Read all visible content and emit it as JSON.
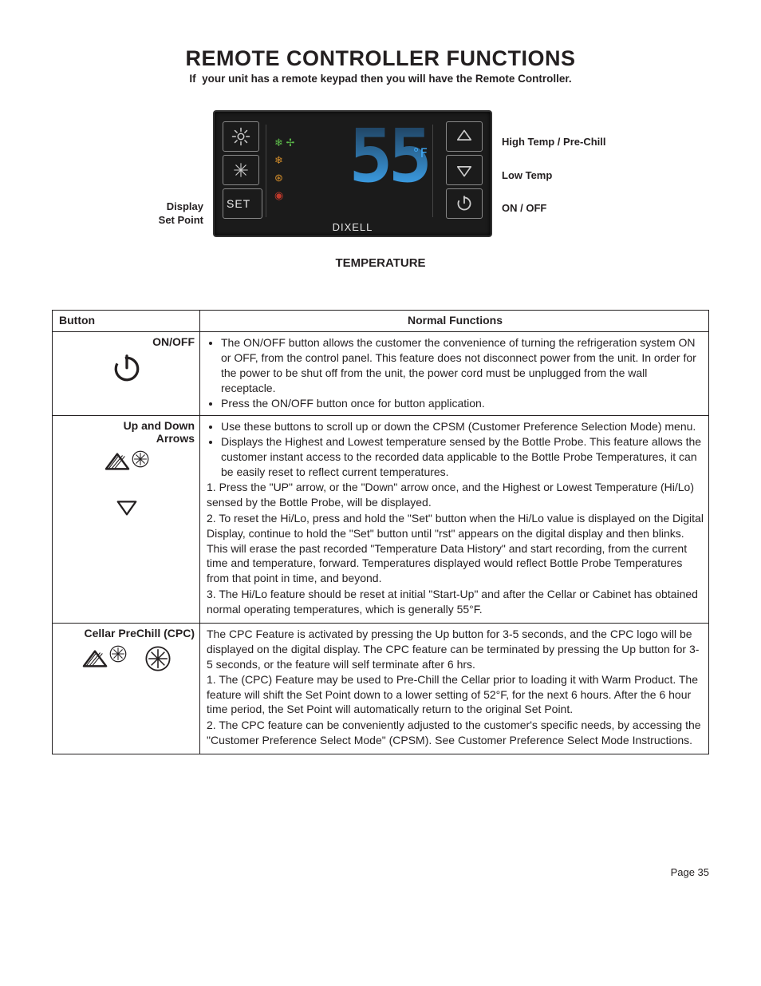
{
  "heading": "REMOTE CONTROLLER FUNCTIONS",
  "subheading_prefix": "If",
  "subheading_rest": "your unit has a remote keypad then you will have the Remote Controller.",
  "left_label_line1": "Display",
  "left_label_line2": "Set Point",
  "right_label_1": "High Temp / Pre-Chill",
  "right_label_2": "Low Temp",
  "right_label_3": "ON / OFF",
  "device": {
    "brand": "DIXELL",
    "set_label": "SET",
    "lcd_value": "55",
    "lcd_unit": "°F"
  },
  "section_head": "TEMPERATURE",
  "table": {
    "col1": "Button",
    "col2": "Normal Functions",
    "row1": {
      "label": "ON/OFF",
      "b1": "The ON/OFF button allows the customer the convenience of turning the refrigeration system ON or OFF, from the control panel.  This feature does not disconnect power from the unit.  In order for the power to be shut off from the unit, the power cord must be unplugged from the wall receptacle.",
      "b2": "Press the ON/OFF button once for button application."
    },
    "row2": {
      "label_l1": "Up and Down",
      "label_l2": "Arrows",
      "b1": "Use these buttons to scroll up or down the CPSM (Customer Preference Selection Mode) menu.",
      "b2": "Displays the Highest and Lowest temperature sensed by the Bottle Probe.  This feature allows the customer instant access to the recorded data applicable to the Bottle Probe Temperatures, it can be easily reset to reflect current temperatures.",
      "s1": "1.  Press the \"UP\" arrow, or the \"Down\" arrow once, and the Highest or Lowest Temperature (Hi/Lo) sensed by the Bottle Probe, will be displayed.",
      "s2": "2.  To reset the Hi/Lo, press and hold the \"Set\" button when the Hi/Lo value is displayed on the Digital Display, continue to hold the \"Set\" button until \"rst\" appears on the digital display and then blinks.  This will erase the past recorded \"Temperature Data History\" and start recording, from the current time and temperature, forward.  Temperatures displayed would reflect Bottle Probe Temperatures from that point in time, and beyond.",
      "s3": "3.  The Hi/Lo feature should be reset at initial \"Start-Up\" and after the Cellar or Cabinet has obtained normal operating temperatures, which is generally 55°F."
    },
    "row3": {
      "label": "Cellar PreChill (CPC)",
      "intro": "The CPC Feature is activated by pressing the Up button for 3-5 seconds, and the CPC logo will be displayed on the digital display.  The CPC feature can be terminated by pressing the Up button for 3-5 seconds, or the feature will self terminate after 6 hrs.",
      "s1": "1.  The (CPC) Feature may be used to Pre-Chill the Cellar prior to loading it with Warm Product.  The feature will shift the Set Point down to a lower setting of 52°F, for the next 6 hours.  After the 6 hour time period, the Set Point will automatically return to the original Set Point.",
      "s2": "2.  The CPC feature can be conveniently adjusted to the customer's specific needs, by accessing the \"Customer Preference Select Mode\" (CPSM).  See Customer Preference Select Mode Instructions."
    }
  },
  "page_number": "Page 35"
}
